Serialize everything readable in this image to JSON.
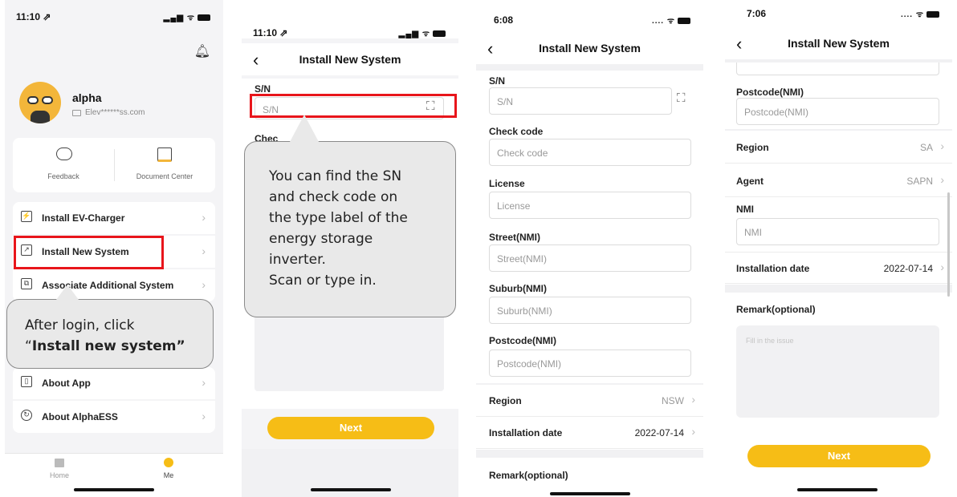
{
  "colors": {
    "accent": "#f6bd16",
    "highlight": "#e8151b"
  },
  "panel1": {
    "time": "11:10 ⇗",
    "bell_icon": "bell-icon",
    "user": {
      "name": "alpha",
      "email": "Elev******ss.com"
    },
    "shortcuts": [
      {
        "label": "Feedback",
        "icon": "feedback-icon"
      },
      {
        "label": "Document Center",
        "icon": "document-icon"
      }
    ],
    "menu": [
      {
        "label": "Install EV-Charger"
      },
      {
        "label": "Install New System"
      },
      {
        "label": "Associate Additional System"
      },
      {
        "label": "About App"
      },
      {
        "label": "About AlphaESS"
      }
    ],
    "callout": {
      "line1": "After login, click",
      "quote_open": "“",
      "bold": "Install new system”"
    },
    "tabs": [
      {
        "label": "Home"
      },
      {
        "label": "Me"
      }
    ]
  },
  "panel2": {
    "time": "11:10 ⇗",
    "title": "Install New System",
    "sn_label": "S/N",
    "sn_placeholder": "S/N",
    "check_label_partial": "Chec",
    "callout": [
      "You can find the SN",
      "and  check code on",
      "the type label of the",
      "energy storage",
      "inverter.",
      "Scan or type in."
    ],
    "next": "Next"
  },
  "panel3": {
    "time": "6:08",
    "title": "Install New System",
    "fields": [
      {
        "label": "S/N",
        "placeholder": "S/N"
      },
      {
        "label": "Check code",
        "placeholder": "Check code"
      },
      {
        "label": "License",
        "placeholder": "License"
      },
      {
        "label": "Street(NMI)",
        "placeholder": "Street(NMI)"
      },
      {
        "label": "Suburb(NMI)",
        "placeholder": "Suburb(NMI)"
      },
      {
        "label": "Postcode(NMI)",
        "placeholder": "Postcode(NMI)"
      }
    ],
    "region_label": "Region",
    "region_value": "NSW",
    "date_label": "Installation date",
    "date_value": "2022-07-14",
    "remark_label": "Remark(optional)"
  },
  "panel4": {
    "time": "7:06",
    "title": "Install New System",
    "postcode_label": "Postcode(NMI)",
    "postcode_placeholder": "Postcode(NMI)",
    "region_label": "Region",
    "region_value": "SA",
    "agent_label": "Agent",
    "agent_value": "SAPN",
    "nmi_label": "NMI",
    "nmi_placeholder": "NMI",
    "date_label": "Installation date",
    "date_value": "2022-07-14",
    "remark_label": "Remark(optional)",
    "remark_placeholder": "Fill in the issue",
    "next": "Next"
  }
}
